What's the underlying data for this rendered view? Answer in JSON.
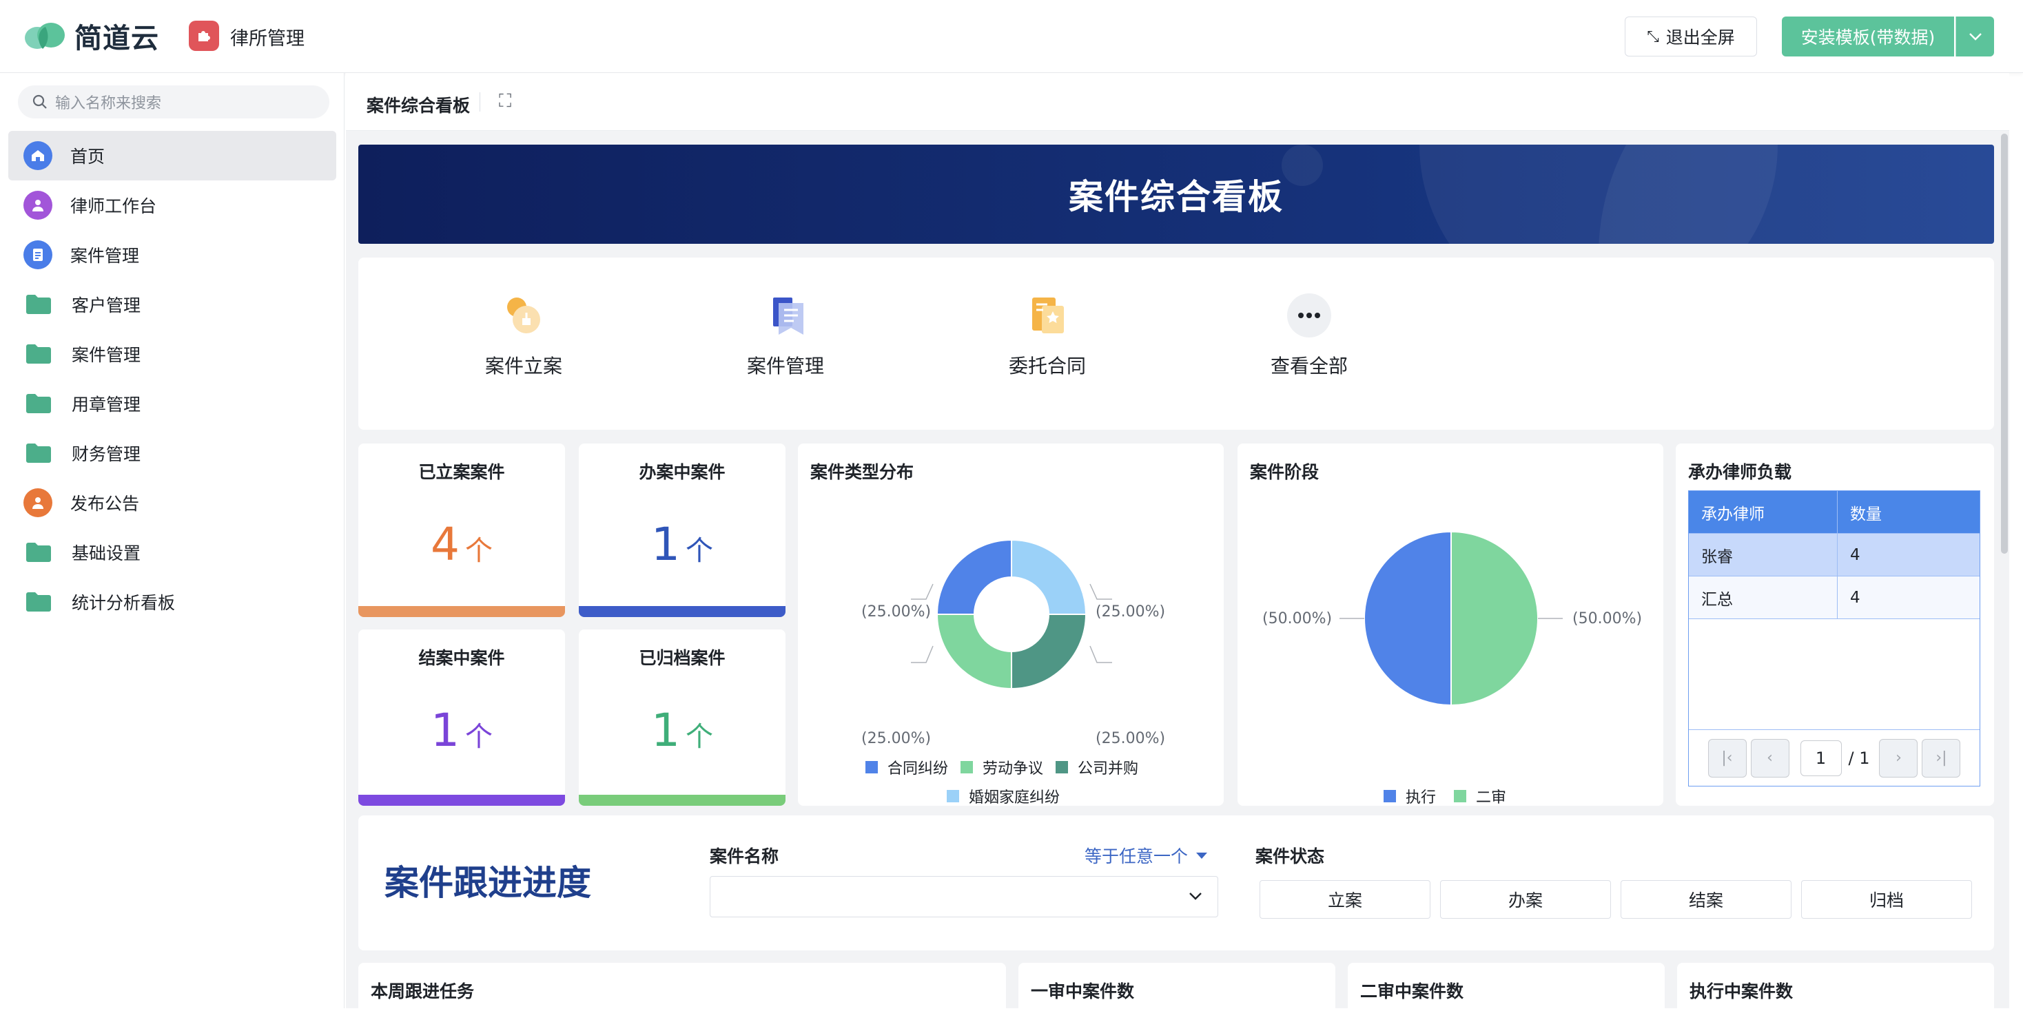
{
  "header": {
    "brand": "简道云",
    "app_name": "律所管理",
    "exit_fullscreen": "退出全屏",
    "install_label": "安装模板(带数据)"
  },
  "sidebar": {
    "search_placeholder": "输入名称来搜索",
    "items": [
      {
        "label": "首页",
        "icon": "home-icon"
      },
      {
        "label": "律师工作台",
        "icon": "person-icon"
      },
      {
        "label": "案件管理",
        "icon": "document-icon"
      },
      {
        "label": "客户管理",
        "icon": "folder-icon"
      },
      {
        "label": "案件管理",
        "icon": "folder-icon"
      },
      {
        "label": "用章管理",
        "icon": "folder-icon"
      },
      {
        "label": "财务管理",
        "icon": "folder-icon"
      },
      {
        "label": "发布公告",
        "icon": "person-icon"
      },
      {
        "label": "基础设置",
        "icon": "folder-icon"
      },
      {
        "label": "统计分析看板",
        "icon": "folder-icon"
      }
    ]
  },
  "tab": {
    "title": "案件综合看板"
  },
  "banner": {
    "title": "案件综合看板"
  },
  "quick": [
    {
      "label": "案件立案"
    },
    {
      "label": "案件管理"
    },
    {
      "label": "委托合同"
    },
    {
      "label": "查看全部"
    }
  ],
  "kpis": [
    {
      "title": "已立案案件",
      "value": "4",
      "unit": "个",
      "color": "#e8783a",
      "bar": "#e8965f"
    },
    {
      "title": "办案中案件",
      "value": "1",
      "unit": "个",
      "color": "#2f55b8",
      "bar": "#3d5cc8"
    },
    {
      "title": "结案中案件",
      "value": "1",
      "unit": "个",
      "color": "#7a44d8",
      "bar": "#7d4ae0"
    },
    {
      "title": "已归档案件",
      "value": "1",
      "unit": "个",
      "color": "#3fae79",
      "bar": "#79cc7a"
    }
  ],
  "chart_data": [
    {
      "type": "pie",
      "variant": "donut",
      "title": "案件类型分布",
      "categories": [
        "合同纠纷",
        "劳动争议",
        "公司并购",
        "婚姻家庭纠纷"
      ],
      "values": [
        25,
        25,
        25,
        25
      ],
      "labels": [
        "(25.00%)",
        "(25.00%)",
        "(25.00%)",
        "(25.00%)"
      ],
      "colors": [
        "#5083e8",
        "#7fd69e",
        "#4f9685",
        "#9bd1f8"
      ],
      "legend_position": "bottom"
    },
    {
      "type": "pie",
      "title": "案件阶段",
      "categories": [
        "执行",
        "二审"
      ],
      "values": [
        50,
        50
      ],
      "labels": [
        "(50.00%)",
        "(50.00%)"
      ],
      "colors": [
        "#5083e8",
        "#7fd69e"
      ],
      "legend_position": "bottom"
    },
    {
      "type": "table",
      "title": "承办律师负载",
      "columns": [
        "承办律师",
        "数量"
      ],
      "rows": [
        [
          "张睿",
          "4"
        ],
        [
          "汇总",
          "4"
        ]
      ],
      "page": "1",
      "total_pages": "/ 1"
    }
  ],
  "follow": {
    "title": "案件跟进进度",
    "case_name_label": "案件名称",
    "operator": "等于任意一个",
    "status_label": "案件状态",
    "statuses": [
      "立案",
      "办案",
      "结案",
      "归档"
    ]
  },
  "bottom": [
    "本周跟进任务",
    "一审中案件数",
    "二审中案件数",
    "执行中案件数"
  ]
}
